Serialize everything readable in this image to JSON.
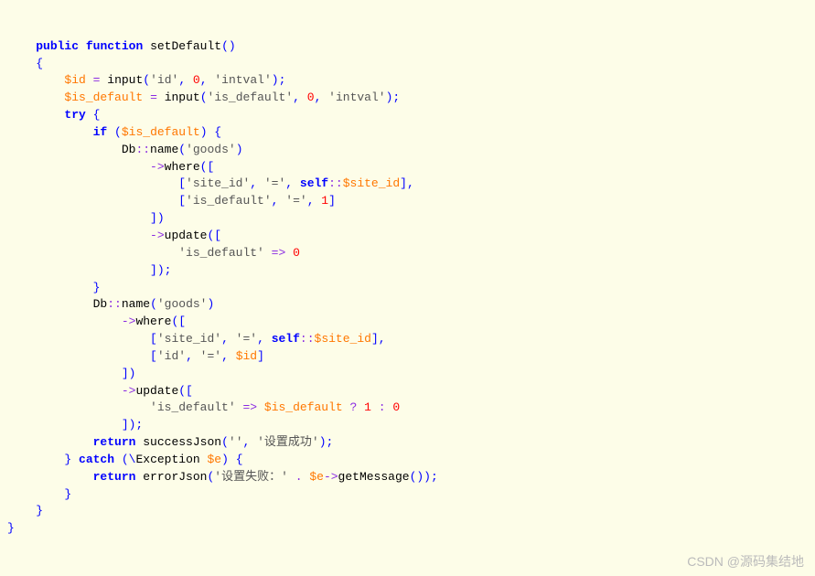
{
  "code": {
    "lines": [
      {
        "indent": 1,
        "tokens": [
          {
            "t": "kw",
            "v": "public"
          },
          {
            "t": "sp",
            "v": " "
          },
          {
            "t": "kw",
            "v": "function"
          },
          {
            "t": "sp",
            "v": " "
          },
          {
            "t": "func",
            "v": "setDefault"
          },
          {
            "t": "punct",
            "v": "()"
          }
        ]
      },
      {
        "indent": 1,
        "tokens": [
          {
            "t": "punct",
            "v": "{"
          }
        ]
      },
      {
        "indent": 2,
        "tokens": [
          {
            "t": "var",
            "v": "$id"
          },
          {
            "t": "sp",
            "v": " "
          },
          {
            "t": "op",
            "v": "="
          },
          {
            "t": "sp",
            "v": " "
          },
          {
            "t": "func",
            "v": "input"
          },
          {
            "t": "punct",
            "v": "("
          },
          {
            "t": "str",
            "v": "'id'"
          },
          {
            "t": "punct",
            "v": ", "
          },
          {
            "t": "num",
            "v": "0"
          },
          {
            "t": "punct",
            "v": ", "
          },
          {
            "t": "str",
            "v": "'intval'"
          },
          {
            "t": "punct",
            "v": ");"
          }
        ]
      },
      {
        "indent": 2,
        "tokens": [
          {
            "t": "var",
            "v": "$is_default"
          },
          {
            "t": "sp",
            "v": " "
          },
          {
            "t": "op",
            "v": "="
          },
          {
            "t": "sp",
            "v": " "
          },
          {
            "t": "func",
            "v": "input"
          },
          {
            "t": "punct",
            "v": "("
          },
          {
            "t": "str",
            "v": "'is_default'"
          },
          {
            "t": "punct",
            "v": ", "
          },
          {
            "t": "num",
            "v": "0"
          },
          {
            "t": "punct",
            "v": ", "
          },
          {
            "t": "str",
            "v": "'intval'"
          },
          {
            "t": "punct",
            "v": ");"
          }
        ]
      },
      {
        "indent": 2,
        "tokens": [
          {
            "t": "kw",
            "v": "try"
          },
          {
            "t": "sp",
            "v": " "
          },
          {
            "t": "punct",
            "v": "{"
          }
        ]
      },
      {
        "indent": 3,
        "tokens": [
          {
            "t": "kw",
            "v": "if"
          },
          {
            "t": "sp",
            "v": " "
          },
          {
            "t": "punct",
            "v": "("
          },
          {
            "t": "var",
            "v": "$is_default"
          },
          {
            "t": "punct",
            "v": ") {"
          }
        ]
      },
      {
        "indent": 4,
        "tokens": [
          {
            "t": "type",
            "v": "Db"
          },
          {
            "t": "op",
            "v": "::"
          },
          {
            "t": "func",
            "v": "name"
          },
          {
            "t": "punct",
            "v": "("
          },
          {
            "t": "str",
            "v": "'goods'"
          },
          {
            "t": "punct",
            "v": ")"
          }
        ]
      },
      {
        "indent": 5,
        "tokens": [
          {
            "t": "arrow",
            "v": "->"
          },
          {
            "t": "func",
            "v": "where"
          },
          {
            "t": "punct",
            "v": "(["
          }
        ]
      },
      {
        "indent": 6,
        "tokens": [
          {
            "t": "punct",
            "v": "["
          },
          {
            "t": "str",
            "v": "'site_id'"
          },
          {
            "t": "punct",
            "v": ", "
          },
          {
            "t": "str",
            "v": "'='"
          },
          {
            "t": "punct",
            "v": ", "
          },
          {
            "t": "kw",
            "v": "self"
          },
          {
            "t": "op",
            "v": "::"
          },
          {
            "t": "var",
            "v": "$site_id"
          },
          {
            "t": "punct",
            "v": "],"
          }
        ]
      },
      {
        "indent": 6,
        "tokens": [
          {
            "t": "punct",
            "v": "["
          },
          {
            "t": "str",
            "v": "'is_default'"
          },
          {
            "t": "punct",
            "v": ", "
          },
          {
            "t": "str",
            "v": "'='"
          },
          {
            "t": "punct",
            "v": ", "
          },
          {
            "t": "num",
            "v": "1"
          },
          {
            "t": "punct",
            "v": "]"
          }
        ]
      },
      {
        "indent": 5,
        "tokens": [
          {
            "t": "punct",
            "v": "])"
          }
        ]
      },
      {
        "indent": 5,
        "tokens": [
          {
            "t": "arrow",
            "v": "->"
          },
          {
            "t": "func",
            "v": "update"
          },
          {
            "t": "punct",
            "v": "(["
          }
        ]
      },
      {
        "indent": 6,
        "tokens": [
          {
            "t": "str",
            "v": "'is_default'"
          },
          {
            "t": "sp",
            "v": " "
          },
          {
            "t": "op",
            "v": "=>"
          },
          {
            "t": "sp",
            "v": " "
          },
          {
            "t": "num",
            "v": "0"
          }
        ]
      },
      {
        "indent": 5,
        "tokens": [
          {
            "t": "punct",
            "v": "]);"
          }
        ]
      },
      {
        "indent": 3,
        "tokens": [
          {
            "t": "punct",
            "v": "}"
          }
        ]
      },
      {
        "indent": 3,
        "tokens": [
          {
            "t": "type",
            "v": "Db"
          },
          {
            "t": "op",
            "v": "::"
          },
          {
            "t": "func",
            "v": "name"
          },
          {
            "t": "punct",
            "v": "("
          },
          {
            "t": "str",
            "v": "'goods'"
          },
          {
            "t": "punct",
            "v": ")"
          }
        ]
      },
      {
        "indent": 4,
        "tokens": [
          {
            "t": "arrow",
            "v": "->"
          },
          {
            "t": "func",
            "v": "where"
          },
          {
            "t": "punct",
            "v": "(["
          }
        ]
      },
      {
        "indent": 5,
        "tokens": [
          {
            "t": "punct",
            "v": "["
          },
          {
            "t": "str",
            "v": "'site_id'"
          },
          {
            "t": "punct",
            "v": ", "
          },
          {
            "t": "str",
            "v": "'='"
          },
          {
            "t": "punct",
            "v": ", "
          },
          {
            "t": "kw",
            "v": "self"
          },
          {
            "t": "op",
            "v": "::"
          },
          {
            "t": "var",
            "v": "$site_id"
          },
          {
            "t": "punct",
            "v": "],"
          }
        ]
      },
      {
        "indent": 5,
        "tokens": [
          {
            "t": "punct",
            "v": "["
          },
          {
            "t": "str",
            "v": "'id'"
          },
          {
            "t": "punct",
            "v": ", "
          },
          {
            "t": "str",
            "v": "'='"
          },
          {
            "t": "punct",
            "v": ", "
          },
          {
            "t": "var",
            "v": "$id"
          },
          {
            "t": "punct",
            "v": "]"
          }
        ]
      },
      {
        "indent": 4,
        "tokens": [
          {
            "t": "punct",
            "v": "])"
          }
        ]
      },
      {
        "indent": 4,
        "tokens": [
          {
            "t": "arrow",
            "v": "->"
          },
          {
            "t": "func",
            "v": "update"
          },
          {
            "t": "punct",
            "v": "(["
          }
        ]
      },
      {
        "indent": 5,
        "tokens": [
          {
            "t": "str",
            "v": "'is_default'"
          },
          {
            "t": "sp",
            "v": " "
          },
          {
            "t": "op",
            "v": "=>"
          },
          {
            "t": "sp",
            "v": " "
          },
          {
            "t": "var",
            "v": "$is_default"
          },
          {
            "t": "sp",
            "v": " "
          },
          {
            "t": "op",
            "v": "?"
          },
          {
            "t": "sp",
            "v": " "
          },
          {
            "t": "num",
            "v": "1"
          },
          {
            "t": "sp",
            "v": " "
          },
          {
            "t": "op",
            "v": ":"
          },
          {
            "t": "sp",
            "v": " "
          },
          {
            "t": "num",
            "v": "0"
          }
        ]
      },
      {
        "indent": 4,
        "tokens": [
          {
            "t": "punct",
            "v": "]);"
          }
        ]
      },
      {
        "indent": 3,
        "tokens": [
          {
            "t": "kw",
            "v": "return"
          },
          {
            "t": "sp",
            "v": " "
          },
          {
            "t": "func",
            "v": "successJson"
          },
          {
            "t": "punct",
            "v": "("
          },
          {
            "t": "str",
            "v": "''"
          },
          {
            "t": "punct",
            "v": ", "
          },
          {
            "t": "str",
            "v": "'设置成功'"
          },
          {
            "t": "punct",
            "v": ");"
          }
        ]
      },
      {
        "indent": 2,
        "tokens": [
          {
            "t": "punct",
            "v": "} "
          },
          {
            "t": "kw",
            "v": "catch"
          },
          {
            "t": "sp",
            "v": " "
          },
          {
            "t": "punct",
            "v": "(\\"
          },
          {
            "t": "type",
            "v": "Exception"
          },
          {
            "t": "sp",
            "v": " "
          },
          {
            "t": "var",
            "v": "$e"
          },
          {
            "t": "punct",
            "v": ") {"
          }
        ]
      },
      {
        "indent": 3,
        "tokens": [
          {
            "t": "kw",
            "v": "return"
          },
          {
            "t": "sp",
            "v": " "
          },
          {
            "t": "func",
            "v": "errorJson"
          },
          {
            "t": "punct",
            "v": "("
          },
          {
            "t": "str",
            "v": "'设置失败：'"
          },
          {
            "t": "sp",
            "v": " "
          },
          {
            "t": "op",
            "v": "."
          },
          {
            "t": "sp",
            "v": " "
          },
          {
            "t": "var",
            "v": "$e"
          },
          {
            "t": "arrow",
            "v": "->"
          },
          {
            "t": "func",
            "v": "getMessage"
          },
          {
            "t": "punct",
            "v": "());"
          }
        ]
      },
      {
        "indent": 2,
        "tokens": [
          {
            "t": "punct",
            "v": "}"
          }
        ]
      },
      {
        "indent": 1,
        "tokens": [
          {
            "t": "punct",
            "v": "}"
          }
        ]
      },
      {
        "indent": 0,
        "tokens": [
          {
            "t": "punct",
            "v": "}"
          }
        ]
      }
    ]
  },
  "watermark": "CSDN @源码集结地",
  "indent_unit": "    "
}
